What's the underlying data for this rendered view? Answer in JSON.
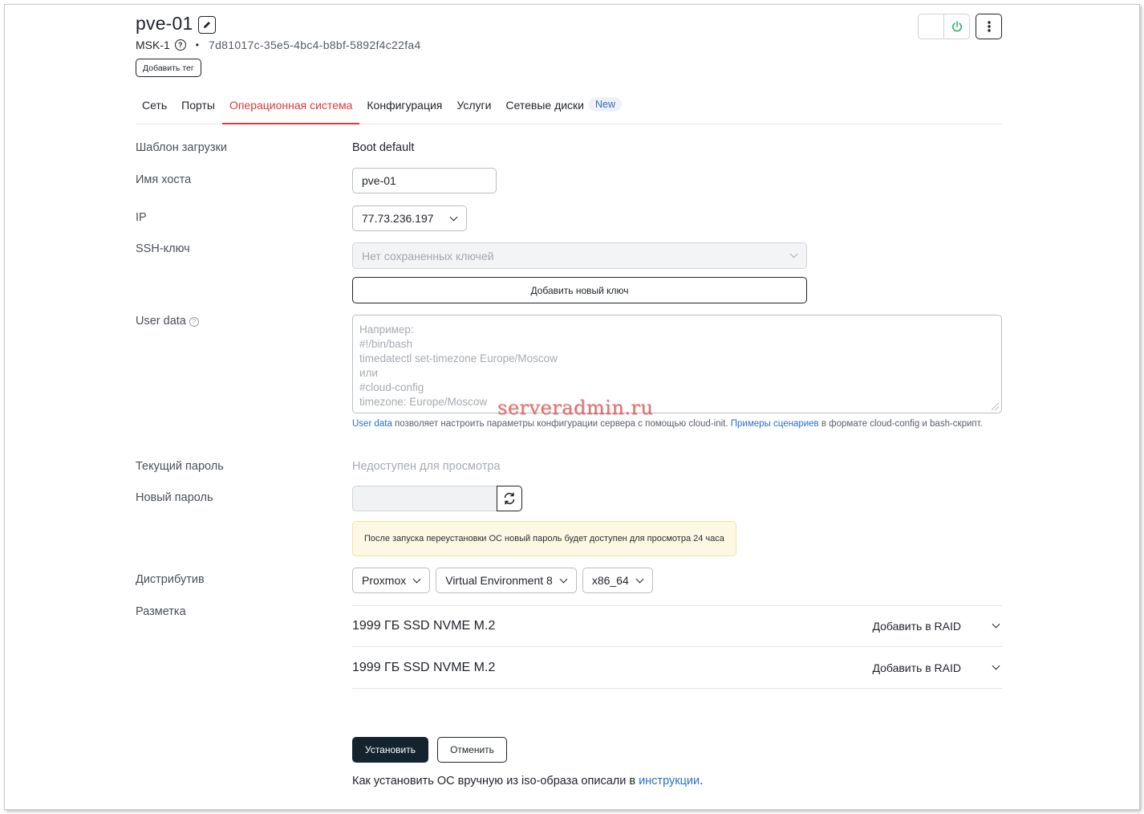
{
  "server": {
    "name": "pve-01",
    "location": "MSK-1",
    "uuid": "7d81017c-35e5-4bc4-b8bf-5892f4c22fa4",
    "add_tag_label": "Добавить тег"
  },
  "tabs": [
    {
      "label": "Сеть"
    },
    {
      "label": "Порты"
    },
    {
      "label": "Операционная система",
      "active": true
    },
    {
      "label": "Конфигурация"
    },
    {
      "label": "Услуги"
    },
    {
      "label": "Сетевые диски",
      "badge": "New"
    }
  ],
  "form": {
    "boot_template": {
      "label": "Шаблон загрузки",
      "value": "Boot default"
    },
    "hostname": {
      "label": "Имя хоста",
      "value": "pve-01"
    },
    "ip": {
      "label": "IP",
      "value": "77.73.236.197"
    },
    "ssh": {
      "label": "SSH-ключ",
      "placeholder": "Нет сохраненных ключей",
      "add_button": "Добавить новый ключ"
    },
    "user_data": {
      "label": "User data",
      "placeholder_lines": [
        "Например:",
        "#!/bin/bash",
        "timedatectl set-timezone Europe/Moscow",
        "или",
        "#cloud-config",
        "timezone: Europe/Moscow"
      ],
      "hint_link1": "User data",
      "hint_text1": " позволяет настроить параметры конфигурации сервера с помощью cloud-init. ",
      "hint_link2": "Примеры сценариев",
      "hint_text2": " в формате cloud-config и bash-скрипт."
    },
    "current_password": {
      "label": "Текущий пароль",
      "value": "Недоступен для просмотра"
    },
    "new_password": {
      "label": "Новый пароль",
      "value": ""
    },
    "notice": "После запуска переустановки ОС новый пароль будет доступен для просмотра 24 часа",
    "distro": {
      "label": "Дистрибутив",
      "os": "Proxmox",
      "version": "Virtual Environment 8",
      "arch": "x86_64"
    },
    "layout": {
      "label": "Разметка",
      "disks": [
        {
          "name": "1999 ГБ SSD NVME M.2",
          "action": "Добавить в RAID"
        },
        {
          "name": "1999 ГБ SSD NVME M.2",
          "action": "Добавить в RAID"
        }
      ]
    }
  },
  "actions": {
    "install": "Установить",
    "cancel": "Отменить"
  },
  "footer": {
    "text": "Как установить ОС вручную из iso-образа описали в ",
    "link": "инструкции",
    "suffix": "."
  },
  "watermark": "serveradmin.ru",
  "colors": {
    "accent": "#e0383e",
    "primary_button": "#14242f",
    "link": "#2a6fca",
    "power": "#2bb673"
  }
}
